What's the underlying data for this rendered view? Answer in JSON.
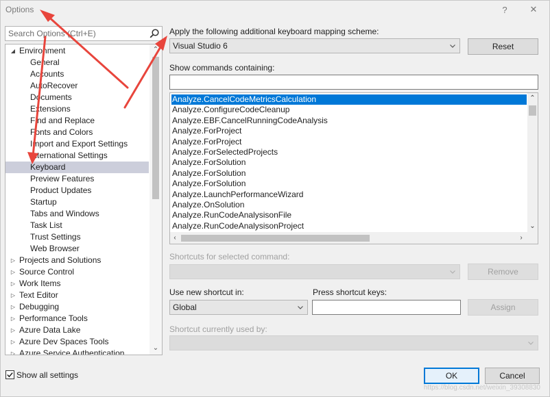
{
  "window": {
    "title": "Options",
    "help_glyph": "?",
    "close_glyph": "✕"
  },
  "search": {
    "placeholder": "Search Options (Ctrl+E)"
  },
  "tree": {
    "items": [
      {
        "label": "Environment",
        "level": 0,
        "expander": "expanded"
      },
      {
        "label": "General",
        "level": 1
      },
      {
        "label": "Accounts",
        "level": 1
      },
      {
        "label": "AutoRecover",
        "level": 1
      },
      {
        "label": "Documents",
        "level": 1
      },
      {
        "label": "Extensions",
        "level": 1
      },
      {
        "label": "Find and Replace",
        "level": 1
      },
      {
        "label": "Fonts and Colors",
        "level": 1
      },
      {
        "label": "Import and Export Settings",
        "level": 1
      },
      {
        "label": "International Settings",
        "level": 1
      },
      {
        "label": "Keyboard",
        "level": 1,
        "selected": true
      },
      {
        "label": "Preview Features",
        "level": 1
      },
      {
        "label": "Product Updates",
        "level": 1
      },
      {
        "label": "Startup",
        "level": 1
      },
      {
        "label": "Tabs and Windows",
        "level": 1
      },
      {
        "label": "Task List",
        "level": 1
      },
      {
        "label": "Trust Settings",
        "level": 1
      },
      {
        "label": "Web Browser",
        "level": 1
      },
      {
        "label": "Projects and Solutions",
        "level": 0,
        "expander": "collapsed"
      },
      {
        "label": "Source Control",
        "level": 0,
        "expander": "collapsed"
      },
      {
        "label": "Work Items",
        "level": 0,
        "expander": "collapsed"
      },
      {
        "label": "Text Editor",
        "level": 0,
        "expander": "collapsed"
      },
      {
        "label": "Debugging",
        "level": 0,
        "expander": "collapsed"
      },
      {
        "label": "Performance Tools",
        "level": 0,
        "expander": "collapsed"
      },
      {
        "label": "Azure Data Lake",
        "level": 0,
        "expander": "collapsed"
      },
      {
        "label": "Azure Dev Spaces Tools",
        "level": 0,
        "expander": "collapsed"
      },
      {
        "label": "Azure Service Authentication",
        "level": 0,
        "expander": "collapsed"
      }
    ]
  },
  "mapping": {
    "label": "Apply the following additional keyboard mapping scheme:",
    "value": "Visual Studio 6",
    "reset_label": "Reset"
  },
  "commands": {
    "label": "Show commands containing:",
    "filter_value": "",
    "items": [
      {
        "label": "Analyze.CancelCodeMetricsCalculation",
        "selected": true
      },
      {
        "label": "Analyze.ConfigureCodeCleanup"
      },
      {
        "label": "Analyze.EBF.CancelRunningCodeAnalysis"
      },
      {
        "label": "Analyze.ForProject"
      },
      {
        "label": "Analyze.ForProject"
      },
      {
        "label": "Analyze.ForSelectedProjects"
      },
      {
        "label": "Analyze.ForSolution"
      },
      {
        "label": "Analyze.ForSolution"
      },
      {
        "label": "Analyze.ForSolution"
      },
      {
        "label": "Analyze.LaunchPerformanceWizard"
      },
      {
        "label": "Analyze.OnSolution"
      },
      {
        "label": "Analyze.RunCodeAnalysisonFile"
      },
      {
        "label": "Analyze.RunCodeAnalysisonProject"
      }
    ]
  },
  "shortcuts": {
    "label": "Shortcuts for selected command:",
    "value": "",
    "remove_label": "Remove"
  },
  "new_shortcut": {
    "use_in_label": "Use new shortcut in:",
    "use_in_value": "Global",
    "press_keys_label": "Press shortcut keys:",
    "press_keys_value": "",
    "assign_label": "Assign"
  },
  "used_by": {
    "label": "Shortcut currently used by:",
    "value": ""
  },
  "footer": {
    "show_all_label": "Show all settings",
    "show_all_checked": true,
    "ok_label": "OK",
    "cancel_label": "Cancel"
  },
  "watermark": "https://blog.csdn.net/weixin_39308830",
  "colors": {
    "accent": "#0078d7",
    "tree_selection": "#cccedb",
    "annotation_arrow": "#e8453c"
  }
}
